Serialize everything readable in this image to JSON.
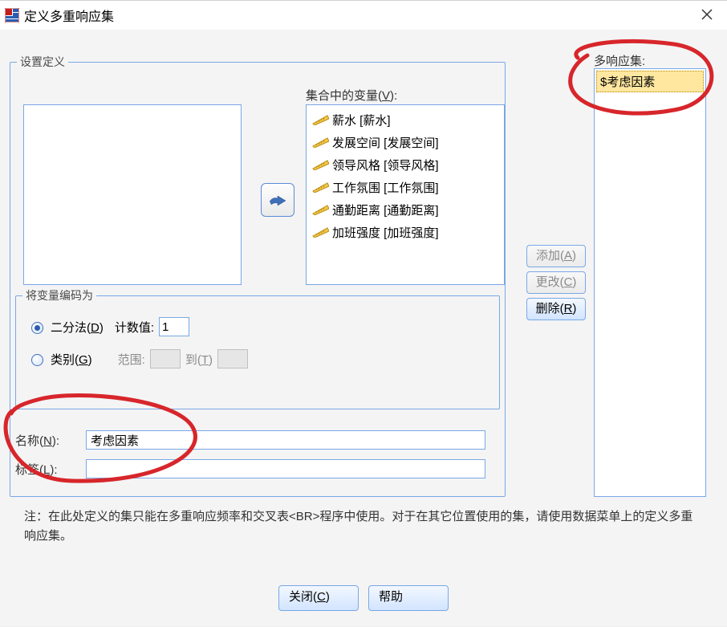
{
  "titlebar": {
    "title": "定义多重响应集"
  },
  "settings": {
    "legend": "设置定义",
    "var_list_label_pre": "集合中的变量(",
    "var_list_label_u": "V",
    "var_list_label_post": "):",
    "target_vars": [
      "薪水 [薪水]",
      "发展空间 [发展空间]",
      "领导风格 [领导风格]",
      "工作氛围 [工作氛围]",
      "通勤距离 [通勤距离]",
      "加班强度 [加班强度]"
    ]
  },
  "encode": {
    "legend": "将变量编码为",
    "opt_dichotomy_pre": "二分法(",
    "opt_dichotomy_u": "D",
    "opt_dichotomy_post": ")",
    "count_label": "计数值:",
    "count_value": "1",
    "opt_category_pre": "类别(",
    "opt_category_u": "G",
    "opt_category_post": ")",
    "range_label": "范围:",
    "range_to_pre": "到(",
    "range_to_u": "T",
    "range_to_post": ")"
  },
  "fields": {
    "name_label_pre": "名称(",
    "name_label_u": "N",
    "name_label_post": "):",
    "name_value": "考虑因素",
    "tag_label_pre": "标签(",
    "tag_label_u": "L",
    "tag_label_post": "):",
    "tag_value": ""
  },
  "right": {
    "label": "多响应集:",
    "selected": "$考虑因素",
    "add_pre": "添加(",
    "add_u": "A",
    "add_post": ")",
    "change_pre": "更改(",
    "change_u": "C",
    "change_post": ")",
    "remove_pre": "删除(",
    "remove_u": "R",
    "remove_post": ")"
  },
  "note": "注：在此处定义的集只能在多重响应频率和交叉表<BR>程序中使用。对于在其它位置使用的集，请使用数据菜单上的定义多重响应集。",
  "bottom": {
    "close_pre": "关闭(",
    "close_u": "C",
    "close_post": ")",
    "help": "帮助"
  }
}
